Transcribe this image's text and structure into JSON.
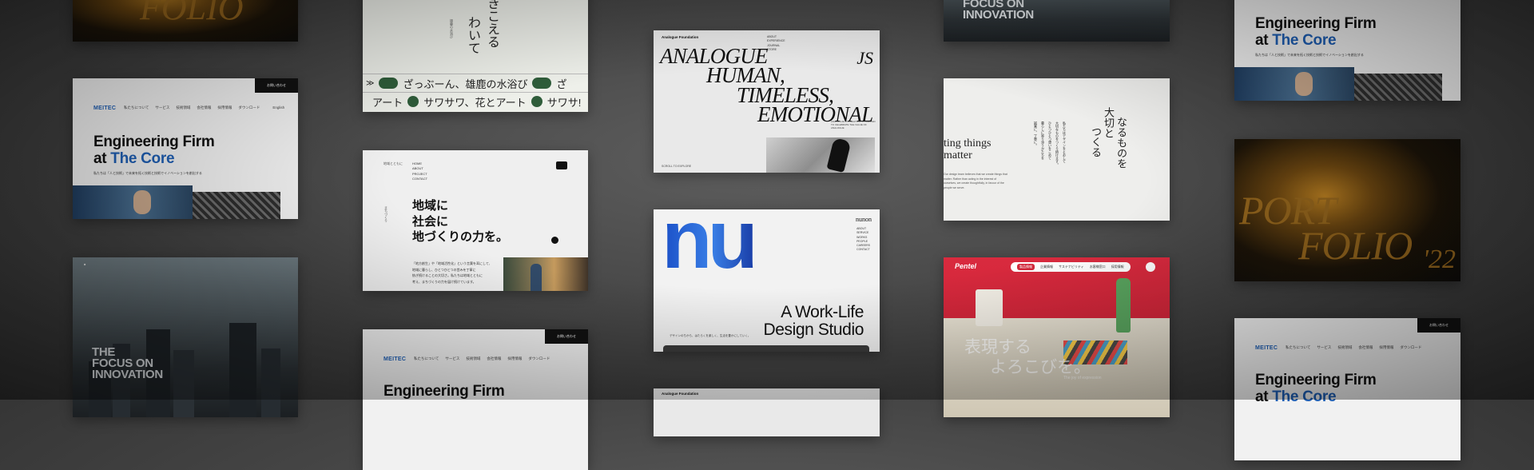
{
  "meitec": {
    "logo": "MEITEC",
    "nav": [
      "私たちについて",
      "サービス",
      "技術領域",
      "会社情報",
      "採用情報",
      "ダウンロード"
    ],
    "nav_extra": "English",
    "cta": "お問い合わせ",
    "headline_1": "Engineering Firm",
    "headline_at": "at ",
    "headline_core": "The Core",
    "subcopy": "私たちは「人と技術」で未来を拓く技術と技術でイノベーションを創出する"
  },
  "portfolio": {
    "word_1": "PORT",
    "word_2": "FOLIO",
    "year": "'22"
  },
  "focus": {
    "line_1": "THE",
    "line_2": "FOCUS ON",
    "line_3": "INNOVATION"
  },
  "kikoeru": {
    "vertical_1": "きこえる",
    "vertical_2": "わいて",
    "small_caption": "雄鹿の水浴び",
    "ticker_1": "ざっぶーん、雄鹿の水浴び",
    "ticker_1_tail": "ざ",
    "ticker_2": "アート",
    "ticker_2_b": "サワサワ、花とアート",
    "ticker_2_tail": "サワサ!"
  },
  "chiiki": {
    "menu": [
      "HOME",
      "ABOUT",
      "PROJECT",
      "CONTACT"
    ],
    "small_label": "地域とともに",
    "line_1": "地域に",
    "line_2": "社会に",
    "line_3": "地づくりの力を。",
    "body": [
      "「地方創生」や「地域活性化」という言葉を耳にして、",
      "地域に暮らし、ひとつひとつの営みを丁寧に",
      "紡ぎ続けることの大切さ。私たちは地域とともに",
      "考え、まちづくりの力を届け続けています。"
    ]
  },
  "analogue": {
    "brand": "Analogue Foundation",
    "nav": [
      "ABOUT",
      "EXPERIENCE",
      "JOURNAL",
      "STORE"
    ],
    "line_1": "ANALOGUE",
    "line_2": "HUMAN,",
    "line_3": "TIMELESS,",
    "line_4": "EMOTIONAL",
    "mark": "JS",
    "caption": "ANALOGUE FOUNDATION IS CREATED TO CELEBRATE THE VALUE OF ANALOGUE",
    "scroll": "SCROLL TO EXPLORE"
  },
  "nu": {
    "glyph": "nu",
    "brand": "nunon",
    "menu": [
      "ABOUT",
      "SERVICE",
      "WORKS",
      "PEOPLE",
      "CAREERS",
      "CONTACT"
    ],
    "title_1": "A Work-Life",
    "title_2": "Design Studio",
    "sub": "デザインのちから、はたらくを楽しく、生活を豊かにしていく。"
  },
  "taisetsu": {
    "title_v1": "大切と",
    "title_v2": "なるものを",
    "title_v3": "つくる",
    "en_1": "ting things",
    "en_2": "matter",
    "body_v": [
      "私たちはデザインをとおして",
      "大切なものをつくり続けます。",
      "ひとつひとつ想いをこめて",
      "暮らしに寄り添うかたちを",
      "誠実に、丁寧に。"
    ],
    "en_small": "Our design team believes that we create things that matter. Rather than acting in the interest of ourselves, we create thoughtfully, in favour of the people we serve."
  },
  "pentel": {
    "logo": "Pentel",
    "nav": [
      "製品情報",
      "企業情報",
      "サステナビリティ",
      "お客様窓口",
      "採用情報"
    ],
    "copy_1": "表現する",
    "copy_2": "よろこびを。",
    "copy_en": "The joy of expression"
  },
  "colors": {
    "meitec_blue": "#1f5fb4",
    "nu_blue": "#1a4fc7",
    "ticker_green": "#2f5d3a",
    "pentel_red": "#d3283b"
  }
}
